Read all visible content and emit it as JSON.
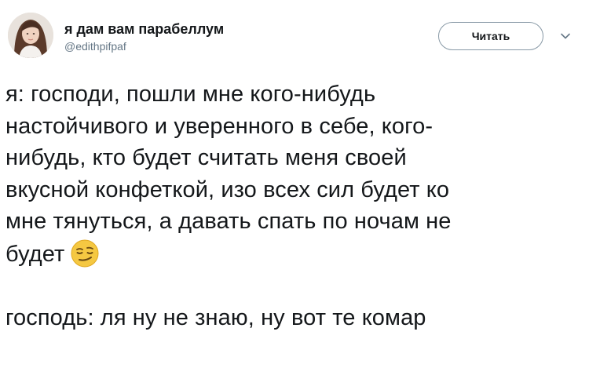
{
  "user": {
    "display_name": "я дам вам парабеллум",
    "handle": "@edithpifpaf",
    "avatar_icon": "user-avatar-photo"
  },
  "actions": {
    "follow_label": "Читать",
    "more_icon": "chevron-down-icon"
  },
  "tweet": {
    "lines": [
      "я: господи, пошли мне кого-нибудь",
      "настойчивого и уверенного в себе, кого-",
      "нибудь, кто будет считать меня своей",
      "вкусной конфеткой, изо всех сил будет ко",
      "мне тянуться, а давать спать по ночам не",
      "будет"
    ],
    "emoji_icon": "smirking-face-emoji",
    "reply_line": "господь: ля ну не знаю, ну вот те комар"
  },
  "colors": {
    "text": "#14171a",
    "secondary": "#657786",
    "button_border": "#8899a6",
    "emoji_yellow": "#f5c842"
  }
}
